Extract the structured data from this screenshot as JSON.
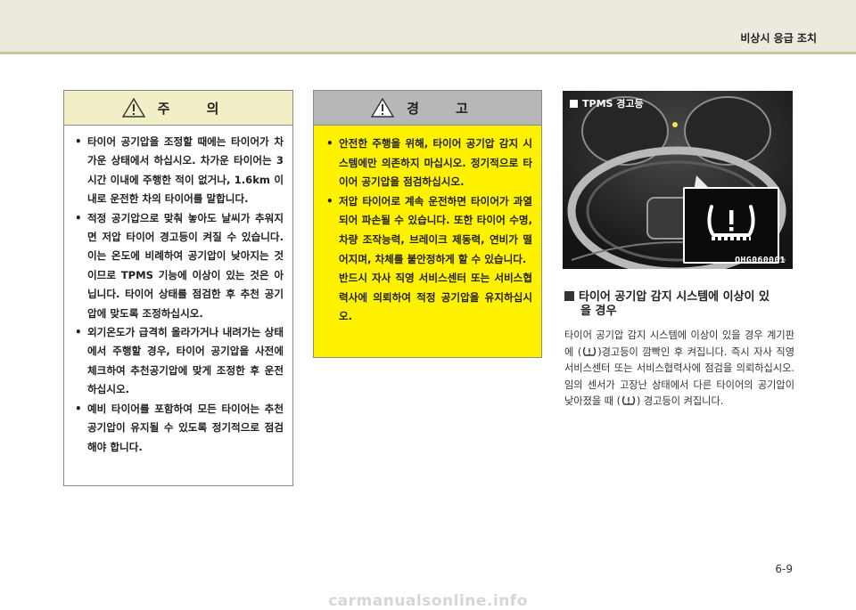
{
  "header": {
    "section_title": "비상시 응급 조치"
  },
  "caution": {
    "title": "주 의",
    "items": [
      "타이어 공기압을 조정할 때에는 타이어가 차가운 상태에서 하십시오. 차가운 타이어는 3시간 이내에 주행한 적이 없거나, 1.6km 이내로 운전한 차의 타이어를 말합니다.",
      "적정 공기압으로 맞춰 놓아도 날씨가 추워지면 저압 타이어 경고등이 켜질 수 있습니다. 이는 온도에 비례하여 공기압이 낮아지는 것이므로 TPMS 기능에 이상이 있는 것은 아닙니다. 타이어 상태를 점검한 후 추천 공기압에 맞도록 조정하십시오.",
      "외기온도가 급격히 올라가거나 내려가는 상태에서 주행할 경우, 타이어 공기압을 사전에 체크하여 추천공기압에 맞게 조정한 후 운전하십시오.",
      "예비 타이어를 포함하여 모든 타이어는 추천 공기압이 유지될 수 있도록 정기적으로 점검해야 합니다."
    ]
  },
  "warning": {
    "title": "경 고",
    "items": [
      "안전한 주행을 위해, 타이어 공기압 감지 시스템에만 의존하지 마십시오. 정기적으로 타이어 공기압을 점검하십시오.",
      "저압 타이어로 계속 운전하면 타이어가 과열되어 파손될 수 있습니다. 또한 타이어 수명, 차량 조작능력, 브레이크 제동력, 연비가 떨어지며, 차체를 불안정하게 할 수 있습니다."
    ],
    "extra": "반드시 자사 직영 서비스센터 또는 서비스협력사에 의뢰하여 적정 공기압을 유지하십시오."
  },
  "photo": {
    "label": "TPMS 경고등",
    "code": "OHG060001"
  },
  "section": {
    "heading_line1": "타이어 공기압 감지 시스템에 이상이 있",
    "heading_line2": "을 경우",
    "body_part1": "타이어 공기압 감지 시스템에 이상이 있을 경우 계기판에 (",
    "body_part2": ")경고등이 깜빡인 후 켜집니다. 즉시 자사 직영 서비스센터 또는 서비스협력사에 점검을 의뢰하십시오. 임의 센서가 고장난 상태에서 다른 타이어의 공기압이 낮아졌을 때 (",
    "body_part3": ") 경고등이 켜집니다."
  },
  "page_number": "6-9",
  "watermark": "carmanualsonline.info",
  "colors": {
    "caution_header": "#f2efc7",
    "warning_background": "#fff200",
    "warning_header": "#b7b7b7",
    "top_band": "#eceadc"
  }
}
